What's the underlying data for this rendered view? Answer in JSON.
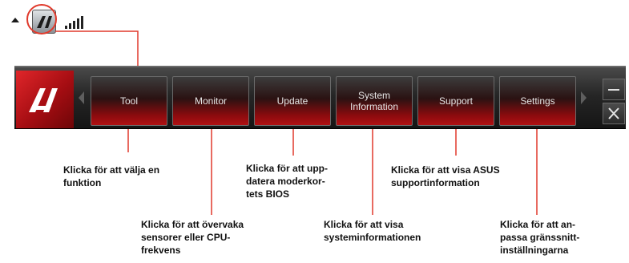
{
  "toolbar": {
    "buttons": [
      {
        "label": "Tool"
      },
      {
        "label": "Monitor"
      },
      {
        "label": "Update"
      },
      {
        "label": "System\nInformation"
      },
      {
        "label": "Support"
      },
      {
        "label": "Settings"
      }
    ]
  },
  "callouts": {
    "tool": "Klicka för att välja en\nfunktion",
    "monitor": "Klicka för att övervaka\nsensorer eller CPU-\nfrekvens",
    "update": "Klicka för att upp-\ndatera moderkor-\ntets BIOS",
    "system_information": "Klicka för att visa\nsysteminformationen",
    "support": "Klicka för att visa ASUS\nsupportinformation",
    "settings": "Klicka för att an-\npassa gränssnitt-\ninställningarna"
  },
  "colors": {
    "accent_red": "#e0392b",
    "button_red": "#b01013",
    "toolbar_dark": "#262626"
  },
  "icons": {
    "tray_arrow": "chevron-up-icon",
    "tray_app": "ai-suite-icon",
    "tray_signal": "signal-bars-icon",
    "logo": "ai-suite-logo-icon",
    "minimize": "minimize-icon",
    "close": "close-icon"
  }
}
